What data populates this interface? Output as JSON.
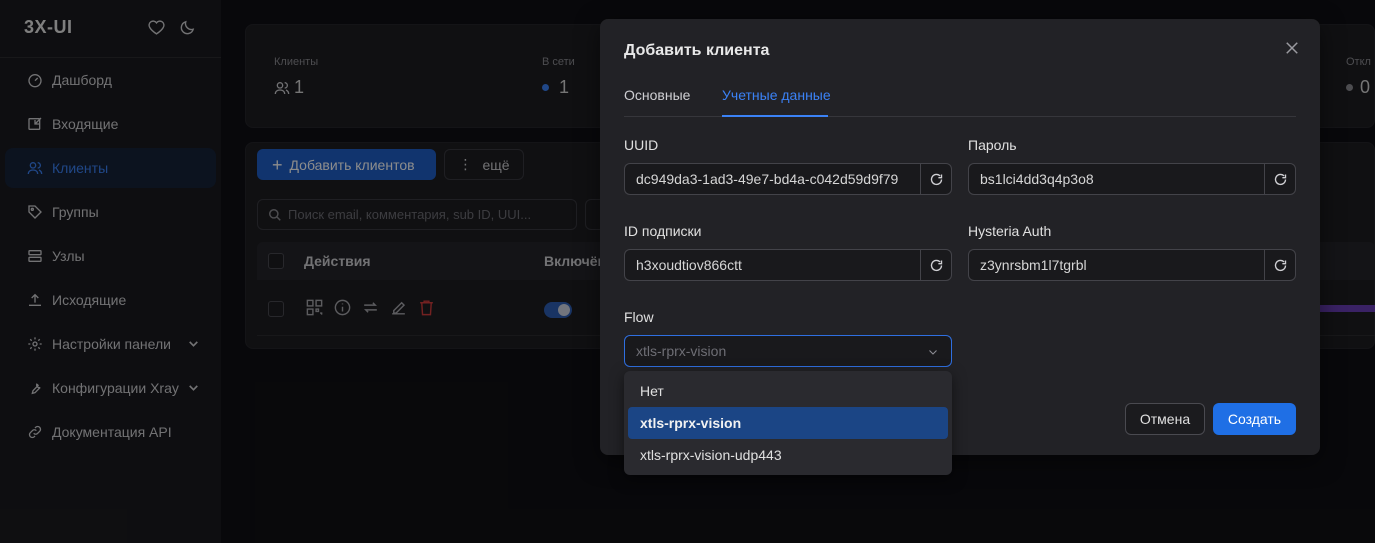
{
  "app": {
    "brand": "3X-UI"
  },
  "sidebar": {
    "items": [
      {
        "label": "Дашборд",
        "icon": "dashboard-icon"
      },
      {
        "label": "Входящие",
        "icon": "inbound-icon"
      },
      {
        "label": "Клиенты",
        "icon": "users-icon",
        "active": true
      },
      {
        "label": "Группы",
        "icon": "tag-icon"
      },
      {
        "label": "Узлы",
        "icon": "nodes-icon"
      },
      {
        "label": "Исходящие",
        "icon": "upload-icon"
      },
      {
        "label": "Настройки панели",
        "icon": "gear-icon",
        "expandable": true
      },
      {
        "label": "Конфигурации Xray",
        "icon": "wrench-icon",
        "expandable": true
      },
      {
        "label": "Документация API",
        "icon": "link-icon"
      }
    ]
  },
  "stats": {
    "clients_label": "Клиенты",
    "clients_value": "1",
    "online_label": "В сети",
    "online_value": "1",
    "disabled_label": "Откл",
    "disabled_value": "0"
  },
  "toolbar": {
    "add_clients_label": "Добавить клиентов",
    "more_label": "ещё",
    "search_placeholder": "Поиск email, комментария, sub ID, UUI..."
  },
  "table": {
    "columns": [
      "Действия",
      "Включён"
    ]
  },
  "modal": {
    "title": "Добавить клиента",
    "tabs": [
      {
        "label": "Основные"
      },
      {
        "label": "Учетные данные",
        "active": true
      }
    ],
    "fields": {
      "uuid": {
        "label": "UUID",
        "value": "dc949da3-1ad3-49e7-bd4a-c042d59d9f79"
      },
      "password": {
        "label": "Пароль",
        "value": "bs1lci4dd3q4p3o8"
      },
      "sub_id": {
        "label": "ID подписки",
        "value": "h3xoudtiov866ctt"
      },
      "hysteria_auth": {
        "label": "Hysteria Auth",
        "value": "z3ynrsbm1l7tgrbl"
      },
      "flow": {
        "label": "Flow",
        "value": "xtls-rprx-vision",
        "options": [
          "Нет",
          "xtls-rprx-vision",
          "xtls-rprx-vision-udp443"
        ]
      }
    },
    "cancel_label": "Отмена",
    "create_label": "Создать"
  },
  "colors": {
    "accent": "#3b82f6",
    "primary_button": "#1f6fe5",
    "background": "#101014",
    "modal": "#222226"
  }
}
